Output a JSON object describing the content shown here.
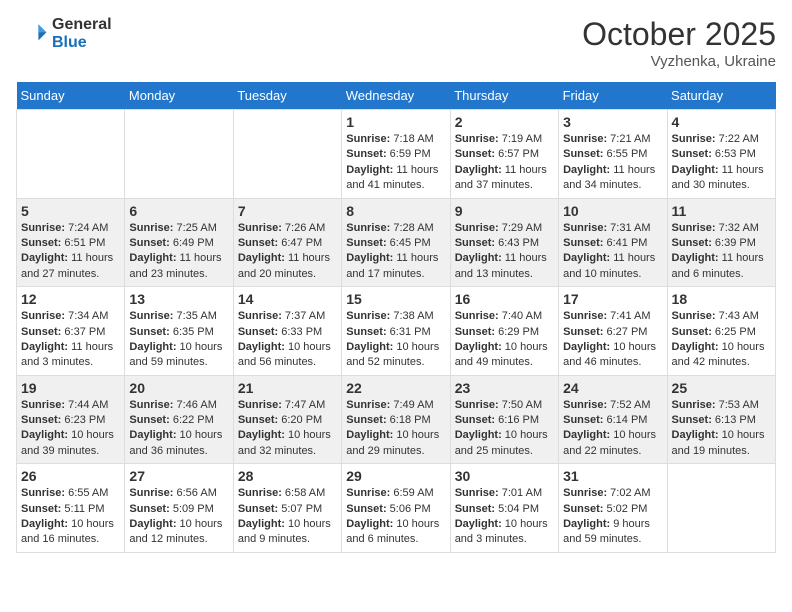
{
  "header": {
    "logo_general": "General",
    "logo_blue": "Blue",
    "month": "October 2025",
    "location": "Vyzhenka, Ukraine"
  },
  "days_of_week": [
    "Sunday",
    "Monday",
    "Tuesday",
    "Wednesday",
    "Thursday",
    "Friday",
    "Saturday"
  ],
  "weeks": [
    [
      {
        "day": "",
        "info": ""
      },
      {
        "day": "",
        "info": ""
      },
      {
        "day": "",
        "info": ""
      },
      {
        "day": "1",
        "info": "Sunrise: 7:18 AM\nSunset: 6:59 PM\nDaylight: 11 hours and 41 minutes."
      },
      {
        "day": "2",
        "info": "Sunrise: 7:19 AM\nSunset: 6:57 PM\nDaylight: 11 hours and 37 minutes."
      },
      {
        "day": "3",
        "info": "Sunrise: 7:21 AM\nSunset: 6:55 PM\nDaylight: 11 hours and 34 minutes."
      },
      {
        "day": "4",
        "info": "Sunrise: 7:22 AM\nSunset: 6:53 PM\nDaylight: 11 hours and 30 minutes."
      }
    ],
    [
      {
        "day": "5",
        "info": "Sunrise: 7:24 AM\nSunset: 6:51 PM\nDaylight: 11 hours and 27 minutes."
      },
      {
        "day": "6",
        "info": "Sunrise: 7:25 AM\nSunset: 6:49 PM\nDaylight: 11 hours and 23 minutes."
      },
      {
        "day": "7",
        "info": "Sunrise: 7:26 AM\nSunset: 6:47 PM\nDaylight: 11 hours and 20 minutes."
      },
      {
        "day": "8",
        "info": "Sunrise: 7:28 AM\nSunset: 6:45 PM\nDaylight: 11 hours and 17 minutes."
      },
      {
        "day": "9",
        "info": "Sunrise: 7:29 AM\nSunset: 6:43 PM\nDaylight: 11 hours and 13 minutes."
      },
      {
        "day": "10",
        "info": "Sunrise: 7:31 AM\nSunset: 6:41 PM\nDaylight: 11 hours and 10 minutes."
      },
      {
        "day": "11",
        "info": "Sunrise: 7:32 AM\nSunset: 6:39 PM\nDaylight: 11 hours and 6 minutes."
      }
    ],
    [
      {
        "day": "12",
        "info": "Sunrise: 7:34 AM\nSunset: 6:37 PM\nDaylight: 11 hours and 3 minutes."
      },
      {
        "day": "13",
        "info": "Sunrise: 7:35 AM\nSunset: 6:35 PM\nDaylight: 10 hours and 59 minutes."
      },
      {
        "day": "14",
        "info": "Sunrise: 7:37 AM\nSunset: 6:33 PM\nDaylight: 10 hours and 56 minutes."
      },
      {
        "day": "15",
        "info": "Sunrise: 7:38 AM\nSunset: 6:31 PM\nDaylight: 10 hours and 52 minutes."
      },
      {
        "day": "16",
        "info": "Sunrise: 7:40 AM\nSunset: 6:29 PM\nDaylight: 10 hours and 49 minutes."
      },
      {
        "day": "17",
        "info": "Sunrise: 7:41 AM\nSunset: 6:27 PM\nDaylight: 10 hours and 46 minutes."
      },
      {
        "day": "18",
        "info": "Sunrise: 7:43 AM\nSunset: 6:25 PM\nDaylight: 10 hours and 42 minutes."
      }
    ],
    [
      {
        "day": "19",
        "info": "Sunrise: 7:44 AM\nSunset: 6:23 PM\nDaylight: 10 hours and 39 minutes."
      },
      {
        "day": "20",
        "info": "Sunrise: 7:46 AM\nSunset: 6:22 PM\nDaylight: 10 hours and 36 minutes."
      },
      {
        "day": "21",
        "info": "Sunrise: 7:47 AM\nSunset: 6:20 PM\nDaylight: 10 hours and 32 minutes."
      },
      {
        "day": "22",
        "info": "Sunrise: 7:49 AM\nSunset: 6:18 PM\nDaylight: 10 hours and 29 minutes."
      },
      {
        "day": "23",
        "info": "Sunrise: 7:50 AM\nSunset: 6:16 PM\nDaylight: 10 hours and 25 minutes."
      },
      {
        "day": "24",
        "info": "Sunrise: 7:52 AM\nSunset: 6:14 PM\nDaylight: 10 hours and 22 minutes."
      },
      {
        "day": "25",
        "info": "Sunrise: 7:53 AM\nSunset: 6:13 PM\nDaylight: 10 hours and 19 minutes."
      }
    ],
    [
      {
        "day": "26",
        "info": "Sunrise: 6:55 AM\nSunset: 5:11 PM\nDaylight: 10 hours and 16 minutes."
      },
      {
        "day": "27",
        "info": "Sunrise: 6:56 AM\nSunset: 5:09 PM\nDaylight: 10 hours and 12 minutes."
      },
      {
        "day": "28",
        "info": "Sunrise: 6:58 AM\nSunset: 5:07 PM\nDaylight: 10 hours and 9 minutes."
      },
      {
        "day": "29",
        "info": "Sunrise: 6:59 AM\nSunset: 5:06 PM\nDaylight: 10 hours and 6 minutes."
      },
      {
        "day": "30",
        "info": "Sunrise: 7:01 AM\nSunset: 5:04 PM\nDaylight: 10 hours and 3 minutes."
      },
      {
        "day": "31",
        "info": "Sunrise: 7:02 AM\nSunset: 5:02 PM\nDaylight: 9 hours and 59 minutes."
      },
      {
        "day": "",
        "info": ""
      }
    ]
  ]
}
